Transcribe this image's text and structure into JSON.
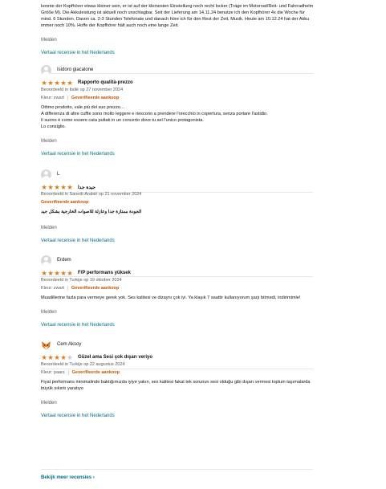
{
  "intro": {
    "text": "konnte der Kopfhörer etwas kleiner sein, er ist auf der kleinesten Einstellung noch recht locker (Träge im Motorrad/Reit- und Fahrradhelm Größe M). Die Akkuleistung ist aktuell noch unschlagbar. Seit der Lieferung am 14.11.24 benutze ich den Kopfhörer 4x die Woche für mind. 6 Stunden. Davon ca. 2-3 Stunden Telefonate und danach höre ich für den Rest der Zeit, Musik. Heute am 10.12.24 hat der Akku immer noch 10%. Hoffe der Kopfhörer hält auch noch eine lange Zeit.",
    "report": "Melden",
    "translate": "Vertaal recensie in het Nederlands"
  },
  "reviews": [
    {
      "reviewer": "Isidoro giacalone",
      "stars": 5,
      "title": "Rapporto qualità-prezzo",
      "meta": "Beoordeeld in Italië op 27 november 2024",
      "color": "Kleur: zwart",
      "verified": "Geverifieerde aankoop",
      "body": "Ottimo prodotto, vale più del suo prezzo…\nA differenza di altre cuffie sono molto leggere e riescono a prendere l'orecchio in copertura, senza portare l'astidio.\nIl suono è come essere cata pultati in un concerto dove tu sei l'unico protagonista.\nLo consiglio.",
      "report": "Melden",
      "translate": "Vertaal recensie in het Nederlands"
    },
    {
      "reviewer": "L",
      "stars": 5,
      "title": "جيدة جدا",
      "meta": "Beoordeeld in Saoedi-Arabië op 21 november 2024",
      "color": "",
      "verified": "Geverifieerde aankoop",
      "body": "الجودة ممتازة جدا وعازلة للاصوات الخارجية بشكل جيد",
      "report": "Melden",
      "translate": "Vertaal recensie in het Nederlands"
    },
    {
      "reviewer": "Erdem",
      "stars": 5,
      "title": "F/P performans yüksek",
      "meta": "Beoordeeld in Turkije op 19 oktober 2024",
      "color": "Kleur: zwart",
      "verified": "Geverifieerde aankoop",
      "body": "Muadillerine fazla para vermeye gerek yok. Ses kalitesi ve dizaynı çok iyi. Ya klaşık 7 saattir kullanıyorum şarjı bitmedi, indirimimle!",
      "report": "Melden",
      "translate": "Vertaal recensie in het Nederlands"
    },
    {
      "reviewer": "Cem Aksoy",
      "stars": 4,
      "title": "Güzel ama Sesi çok dışarı veriyo",
      "meta": "Beoordeeld in Turkije op 22 augustus 2024",
      "color": "Kleur: paars",
      "verified": "Geverifieerde aankoop",
      "body": "Fiyat performans minimalinde baktığımızda iyiye yakın, ses kalitesi fakat tek sorunun sesi olduğu gibi dışarı vermesi toplum taşımalarda büyük sıkıntı yaratıyo",
      "report": "Melden",
      "translate": "Vertaal recensie in het Nederlands"
    }
  ],
  "footer": {
    "more_link": "Bekijk meer recensies ›"
  },
  "colors": {
    "star": "#de7921",
    "link": "#007185",
    "verified": "#c45500",
    "muted": "#565959"
  }
}
